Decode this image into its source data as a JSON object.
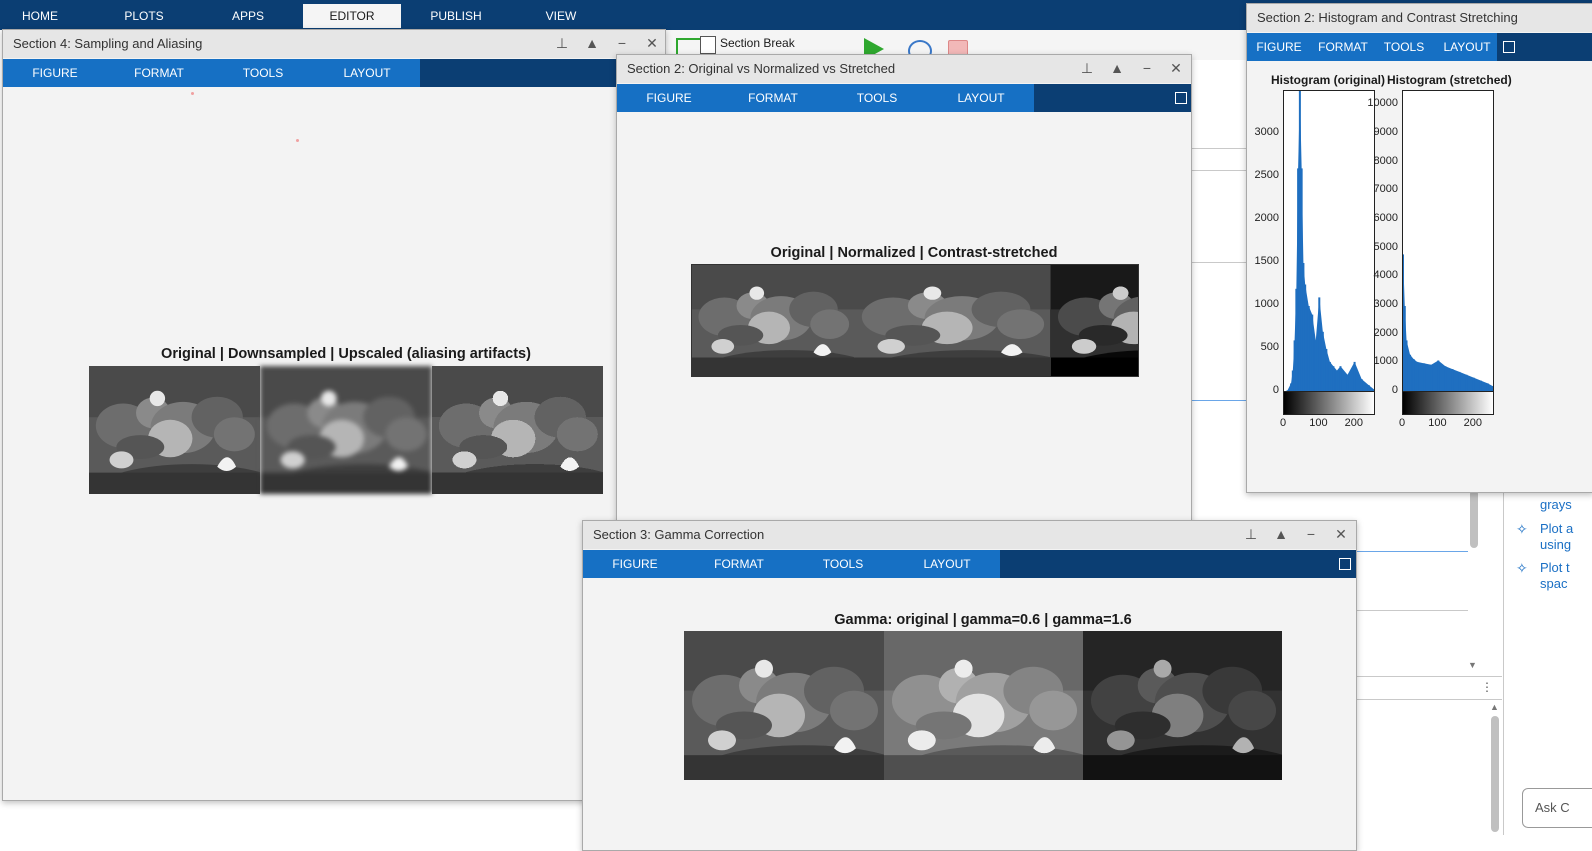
{
  "main_tabs": [
    "HOME",
    "PLOTS",
    "APPS",
    "EDITOR",
    "PUBLISH",
    "VIEW"
  ],
  "active_main_tab": "EDITOR",
  "toolstrip": {
    "section_break_label": "Section Break"
  },
  "copilot": {
    "items": [
      "grays",
      "Plot a\nusing",
      "Plot t\nspac"
    ],
    "ask_placeholder": "Ask C"
  },
  "windows": {
    "sampling": {
      "title": "Section 4: Sampling and Aliasing",
      "tabs": [
        "FIGURE",
        "FORMAT",
        "TOOLS",
        "LAYOUT"
      ],
      "axes_title": "Original | Downsampled | Upscaled (aliasing artifacts)"
    },
    "normalized": {
      "title": "Section 2: Original vs Normalized vs Stretched",
      "tabs": [
        "FIGURE",
        "FORMAT",
        "TOOLS",
        "LAYOUT"
      ],
      "axes_title": "Original | Normalized | Contrast-stretched"
    },
    "histogram": {
      "title": "Section 2: Histogram and Contrast Stretching",
      "tabs": [
        "FIGURE",
        "FORMAT",
        "TOOLS",
        "LAYOUT"
      ],
      "left_title": "Histogram (original)",
      "right_title": "Histogram (stretched)",
      "left_yticks": [
        "3000",
        "2500",
        "2000",
        "1500",
        "1000",
        "500",
        "0"
      ],
      "right_yticks": [
        "10000",
        "9000",
        "8000",
        "7000",
        "6000",
        "5000",
        "4000",
        "3000",
        "2000",
        "1000",
        "0"
      ],
      "xticks": [
        "0",
        "100",
        "200"
      ]
    },
    "gamma": {
      "title": "Section 3: Gamma Correction",
      "tabs": [
        "FIGURE",
        "FORMAT",
        "TOOLS",
        "LAYOUT"
      ],
      "axes_title": "Gamma: original | gamma=0.6 | gamma=1.6"
    }
  },
  "chart_data": [
    {
      "type": "bar",
      "title": "Histogram (original)",
      "xlabel": "",
      "ylabel": "",
      "xlim": [
        0,
        255
      ],
      "ylim": [
        0,
        3500
      ],
      "x": [
        10,
        20,
        25,
        30,
        35,
        40,
        45,
        50,
        55,
        60,
        70,
        80,
        90,
        100,
        110,
        120,
        130,
        140,
        150,
        160,
        180,
        200,
        220,
        240,
        255
      ],
      "values": [
        20,
        100,
        250,
        600,
        1200,
        2600,
        3500,
        2600,
        1500,
        1250,
        1000,
        900,
        600,
        1100,
        700,
        500,
        350,
        300,
        250,
        300,
        200,
        350,
        150,
        80,
        30
      ]
    },
    {
      "type": "bar",
      "title": "Histogram (stretched)",
      "xlabel": "",
      "ylabel": "",
      "xlim": [
        0,
        255
      ],
      "ylim": [
        0,
        10500
      ],
      "x": [
        0,
        5,
        10,
        20,
        30,
        40,
        60,
        80,
        100,
        120,
        140,
        160,
        180,
        200,
        220,
        240,
        255
      ],
      "values": [
        4800,
        3000,
        1800,
        1300,
        1150,
        1050,
        1000,
        950,
        1100,
        900,
        800,
        700,
        600,
        500,
        400,
        300,
        200
      ]
    }
  ]
}
